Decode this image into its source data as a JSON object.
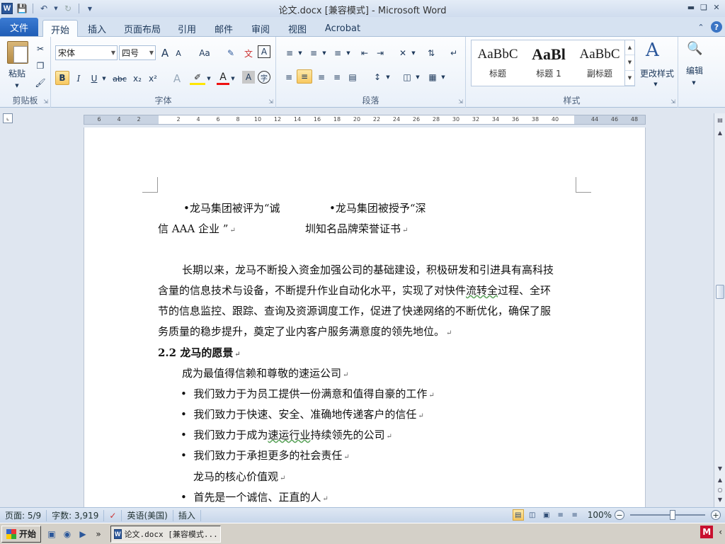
{
  "window": {
    "title": "论文.docx [兼容模式] - Microsoft Word",
    "app_icon_letter": "W"
  },
  "tabs": {
    "file": "文件",
    "items": [
      "开始",
      "插入",
      "页面布局",
      "引用",
      "邮件",
      "审阅",
      "视图",
      "Acrobat"
    ],
    "active_index": 0
  },
  "ribbon": {
    "clipboard": {
      "label": "剪贴板",
      "paste": "粘贴"
    },
    "font": {
      "label": "字体",
      "font_name": "宋体",
      "font_size": "四号",
      "grow": "A",
      "shrink": "A",
      "case": "Aa",
      "bold": "B",
      "italic": "I",
      "underline": "U",
      "strike": "abc",
      "subscript": "x₂",
      "superscript": "x²"
    },
    "paragraph": {
      "label": "段落"
    },
    "styles": {
      "label": "样式",
      "items": [
        {
          "sample": "AaBbC",
          "name": "标题"
        },
        {
          "sample": "AaBl",
          "name": "标题 1"
        },
        {
          "sample": "AaBbC",
          "name": "副标题"
        }
      ],
      "change_styles": "更改样式"
    },
    "editing": {
      "label": "编辑"
    }
  },
  "ruler": {
    "ticks": [
      "6",
      "4",
      "2",
      "2",
      "4",
      "6",
      "8",
      "10",
      "12",
      "14",
      "16",
      "18",
      "20",
      "22",
      "24",
      "26",
      "28",
      "30",
      "32",
      "34",
      "36",
      "38",
      "40",
      "44",
      "46",
      "48"
    ]
  },
  "document": {
    "caption_left_1": "•龙马集团被评为“诚",
    "caption_right_1": "•龙马集团被授予“深",
    "caption_left_2": "信 AAA 企业 ”",
    "caption_right_2": "圳知名品牌荣誉证书",
    "para_1": "长期以来，龙马不断投入资金加强公司的基础建设，积极研发和引进具有高科技",
    "para_2a": "含量的信息技术与设备，不断提升作业自动化水平，实现了对快件",
    "para_2b": "流转全",
    "para_2c": "过程、全环",
    "para_3": "节的信息监控、跟踪、查询及资源调度工作，促进了快递网络的不断优化，确保了服",
    "para_4": "务质量的稳步提升，奠定了业内客户服务满意度的领先地位。",
    "heading": "2.2  龙马的愿景",
    "vision": "成为最值得信赖和尊敬的速运公司",
    "bullet_1": "我们致力于为员工提供一份满意和值得自豪的工作",
    "bullet_2": "我们致力于快速、安全、准确地传递客户的信任",
    "bullet_3a": "我们致力于成为",
    "bullet_3b": "速运行业",
    "bullet_3c": "持续领先的公司",
    "bullet_4": "我们致力于承担更多的社会责任",
    "values_title": "龙马的核心价值观",
    "bullet_5": "首先是一个诚信、正直的人",
    "bullet_char": "•",
    "para_mark": "↵"
  },
  "status": {
    "page": "页面: 5/9",
    "words": "字数: 3,919",
    "language": "英语(美国)",
    "mode": "插入",
    "zoom": "100%",
    "zoom_level_percent": 100
  },
  "taskbar": {
    "start": "开始",
    "task": "论文.docx [兼容模式..."
  }
}
